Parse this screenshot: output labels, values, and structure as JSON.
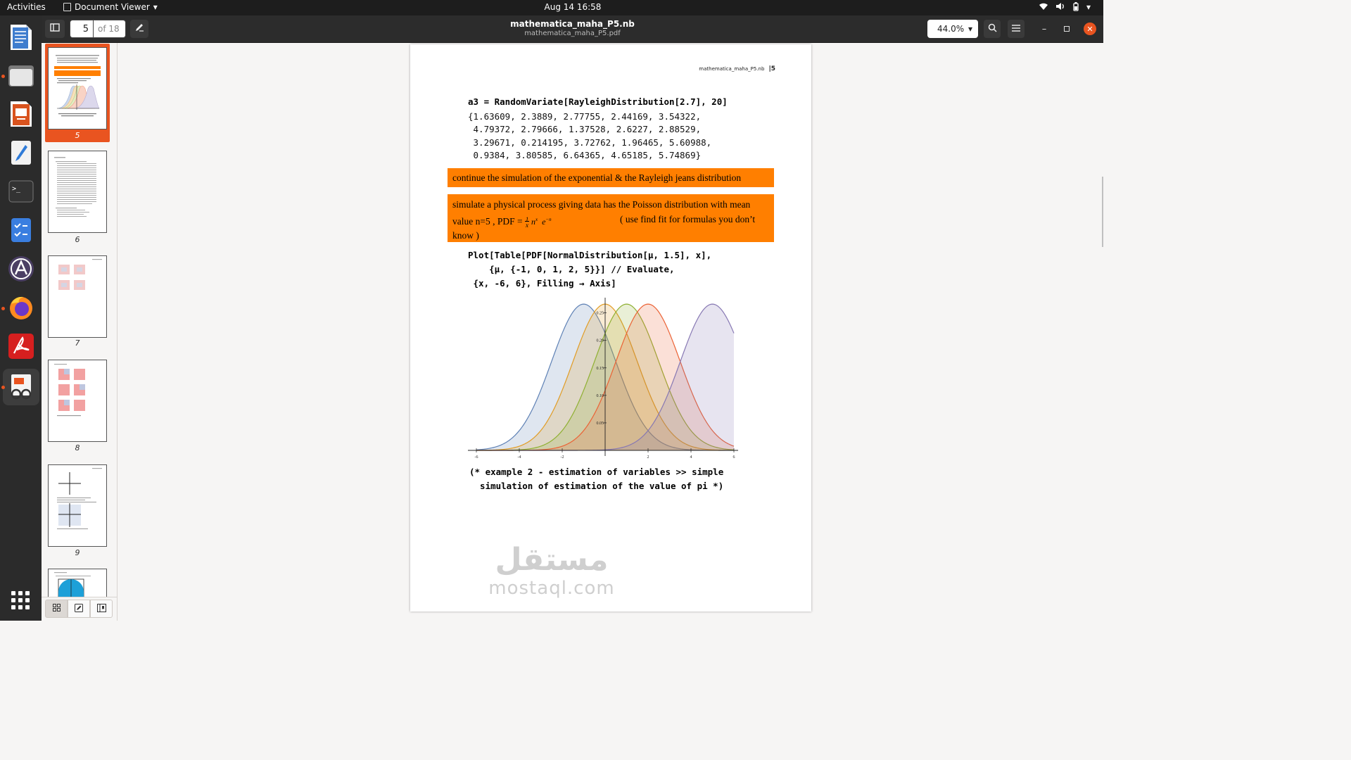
{
  "topbar": {
    "activities": "Activities",
    "app_name": "Document Viewer",
    "clock": "Aug 14  16:58"
  },
  "headerbar": {
    "page_current": "5",
    "page_of": "of 18",
    "title": "mathematica_maha_P5.nb",
    "subtitle": "mathematica_maha_P5.pdf",
    "zoom": "44.0%"
  },
  "sidebar": {
    "thumbnails": [
      {
        "label": "5",
        "selected": true
      },
      {
        "label": "6",
        "selected": false
      },
      {
        "label": "7",
        "selected": false
      },
      {
        "label": "8",
        "selected": false
      },
      {
        "label": "9",
        "selected": false
      }
    ]
  },
  "document": {
    "header_file": "mathematica_maha_P5.nb",
    "header_page": "5",
    "input_a3": "a3 = RandomVariate[RayleighDistribution[2.7], 20]",
    "output_lines": [
      "{1.63609, 2.3889, 2.77755, 2.44169, 3.54322,",
      " 4.79372, 2.79666, 1.37528, 2.6227, 2.88529,",
      " 3.29671, 0.214195, 3.72762, 1.96465, 5.60988,",
      " 0.9384, 3.80585, 6.64365, 4.65185, 5.74869}"
    ],
    "text_box_1": "continue the simulation of the exponential & the Rayleigh jeans distribution",
    "text_box_2_line1": "simulate a physical process giving data has the Poisson distribution with mean",
    "text_box_2_line2a": "value n=5  , PDF = ",
    "text_box_2_line2b": "( use find fit for formulas you don’t",
    "text_box_2_line3": "know )",
    "plot_code": [
      "Plot[Table[PDF[NormalDistribution[μ, 1.5], x],",
      "    {μ, {-1, 0, 1, 2, 5}}] // Evaluate,",
      " {x, -6, 6}, Filling → Axis]"
    ],
    "comment_lines": [
      "(* example 2 - estimation of variables >> simple",
      "  simulation of estimation of the value of pi *)"
    ],
    "watermark_ar": "مستقل",
    "watermark_lat": "mostaql.com"
  },
  "colors": {
    "accent": "#e95420",
    "highlight_box": "#ff7f00"
  },
  "chart_data": {
    "type": "area",
    "function": "PDF[NormalDistribution[mu, 1.5], x]",
    "sigma": 1.5,
    "series": [
      {
        "mu": -1,
        "color": "#5e81b5"
      },
      {
        "mu": 0,
        "color": "#e19c24"
      },
      {
        "mu": 1,
        "color": "#8fb032"
      },
      {
        "mu": 2,
        "color": "#eb6235"
      },
      {
        "mu": 5,
        "color": "#8778b3"
      }
    ],
    "xlim": [
      -6,
      6
    ],
    "ylim": [
      0,
      0.27
    ],
    "x_ticks": [
      "-6",
      "-4",
      "-2",
      "2",
      "4",
      "6"
    ],
    "x_tick_values": [
      -6,
      -4,
      -2,
      2,
      4,
      6
    ],
    "y_ticks": [
      "0.05",
      "0.10",
      "0.15",
      "0.20",
      "0.25"
    ],
    "y_tick_values": [
      0.05,
      0.1,
      0.15,
      0.2,
      0.25
    ],
    "fill": "axis"
  }
}
